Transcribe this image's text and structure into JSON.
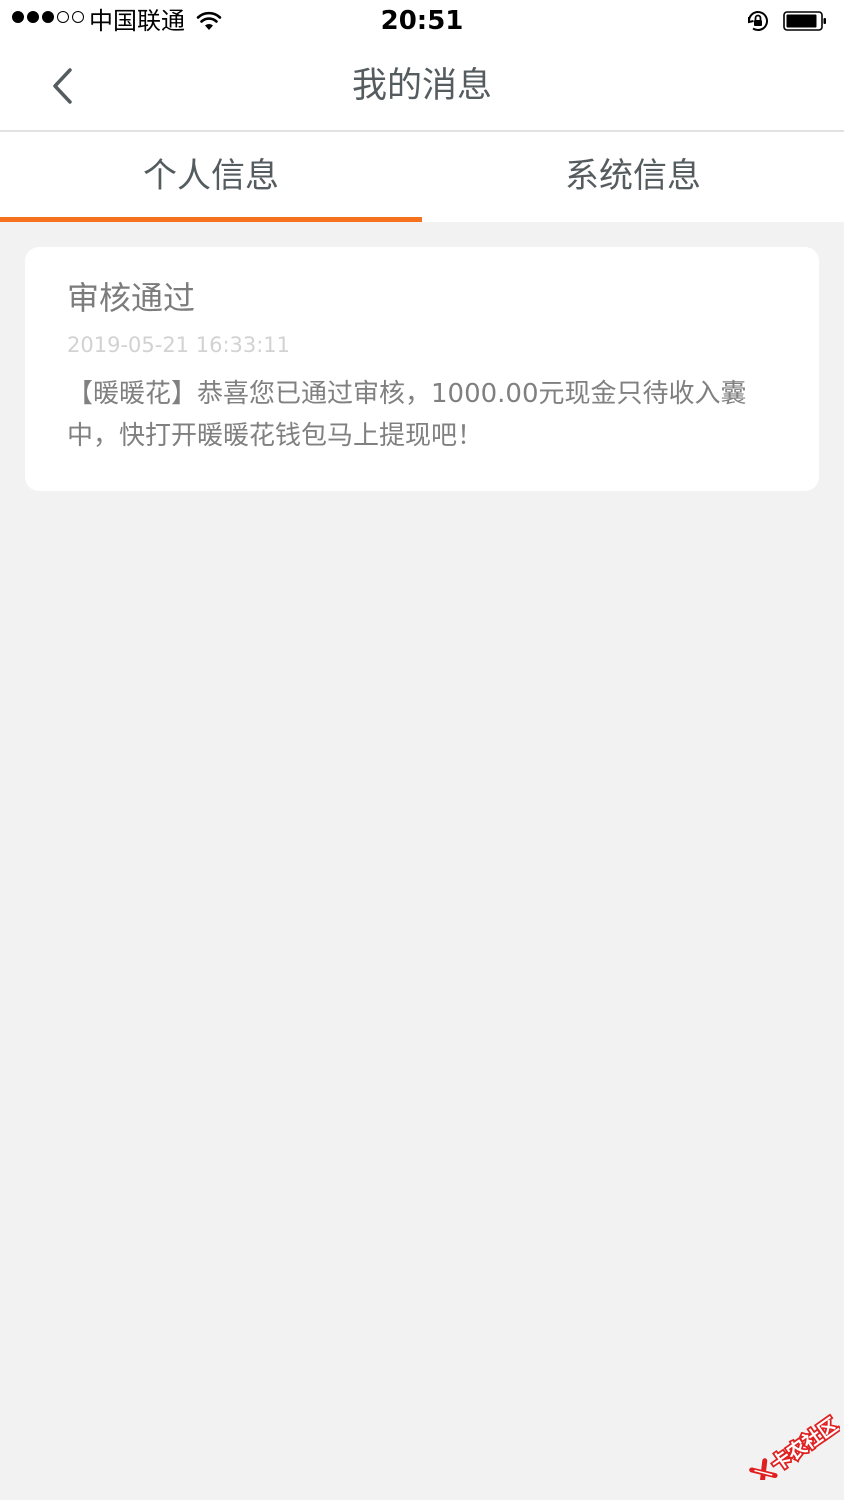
{
  "status_bar": {
    "signal_dots": [
      true,
      true,
      true,
      false,
      false
    ],
    "carrier": "中国联通",
    "time": "20:51",
    "icons": [
      "wifi-icon",
      "rotation-lock-icon",
      "battery-icon"
    ]
  },
  "nav": {
    "back_icon": "chevron-left-icon",
    "title": "我的消息"
  },
  "tabs": [
    {
      "label": "个人信息",
      "active": true
    },
    {
      "label": "系统信息",
      "active": false
    }
  ],
  "messages": [
    {
      "title": "审核通过",
      "time": "2019-05-21 16:33:11",
      "body": "【暖暖花】恭喜您已通过审核，1000.00元现金只待收入囊中，快打开暖暖花钱包马上提现吧！"
    }
  ],
  "watermark": {
    "text": "卡农社区"
  },
  "colors": {
    "accent": "#f5711d",
    "background": "#f2f2f2",
    "title_text": "#555c60",
    "watermark_red": "#e02020"
  }
}
